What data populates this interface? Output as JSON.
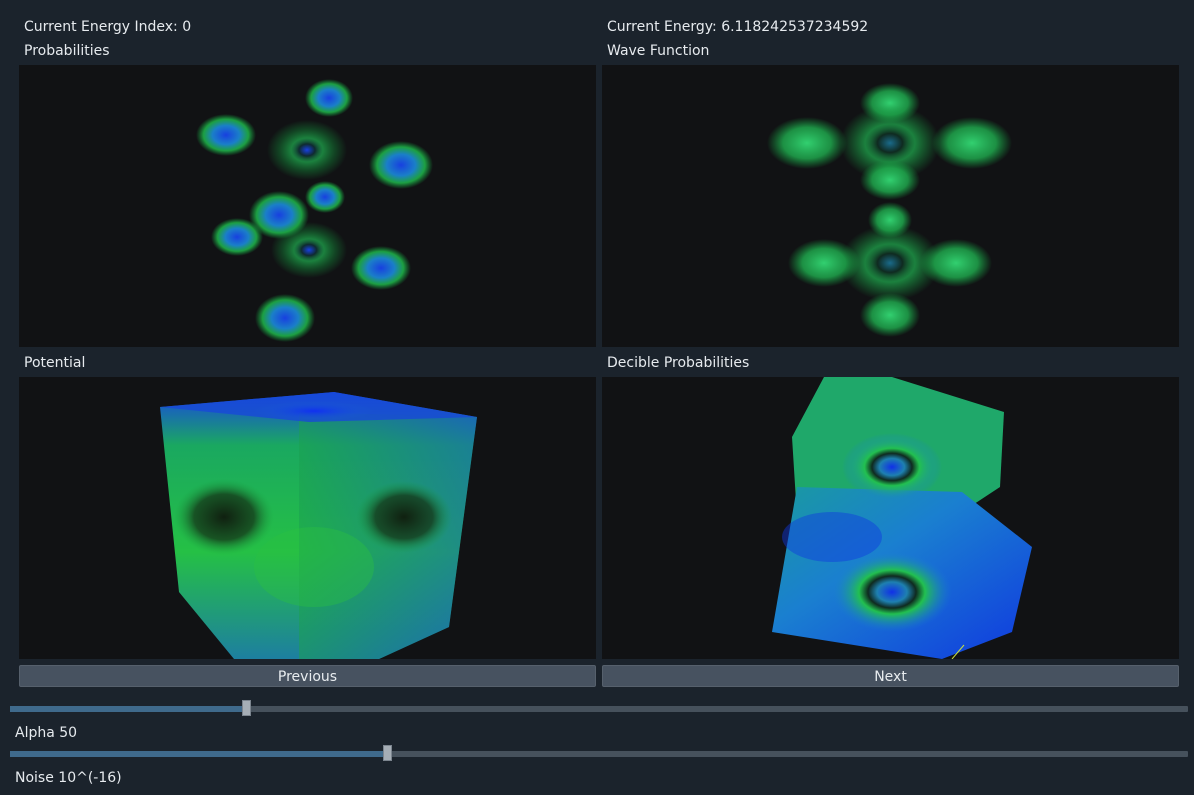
{
  "header": {
    "energy_index_label": "Current Energy Index: 0",
    "energy_value_label": "Current Energy: 6.118242537234592"
  },
  "panels": {
    "probabilities": "Probabilities",
    "wave_function": "Wave Function",
    "potential": "Potential",
    "decible_probabilities": "Decible Probabilities"
  },
  "buttons": {
    "previous": "Previous",
    "next": "Next"
  },
  "sliders": {
    "alpha": {
      "label": "Alpha 50",
      "value": 0.2
    },
    "noise": {
      "label": "Noise 10^(-16)",
      "value": 0.32
    }
  },
  "colors": {
    "background": "#1b232c",
    "viewport": "#111214",
    "accent": "#3f6a8c"
  }
}
